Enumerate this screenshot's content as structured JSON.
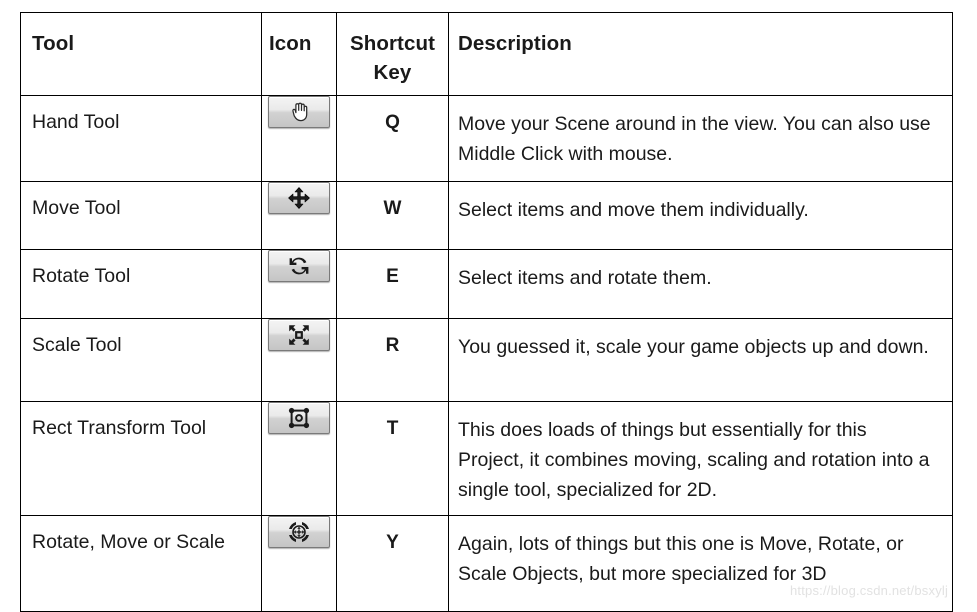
{
  "table": {
    "columns": [
      {
        "label": "Tool",
        "key": "tool"
      },
      {
        "label": "Icon",
        "key": "icon"
      },
      {
        "label": "Shortcut Key",
        "key": "shortcut"
      },
      {
        "label": "Description",
        "key": "description"
      }
    ],
    "header": {
      "tool": "Tool",
      "icon": "Icon",
      "shortcut_line1": "Shortcut",
      "shortcut_line2": "Key",
      "description": "Description"
    },
    "rows": [
      {
        "tool": "Hand Tool",
        "icon": "hand-tool-icon",
        "shortcut": "Q",
        "description": "Move your Scene around in the view. You can also use Middle Click with mouse."
      },
      {
        "tool": "Move Tool",
        "icon": "move-tool-icon",
        "shortcut": "W",
        "description": "Select items and move them individually."
      },
      {
        "tool": "Rotate Tool",
        "icon": "rotate-tool-icon",
        "shortcut": "E",
        "description": "Select items and rotate them."
      },
      {
        "tool": "Scale Tool",
        "icon": "scale-tool-icon",
        "shortcut": "R",
        "description": "You guessed it, scale your game objects up and down."
      },
      {
        "tool": "Rect Transform Tool",
        "icon": "rect-transform-tool-icon",
        "shortcut": "T",
        "description": "This does loads of things but essentially for this Project, it combines moving, scaling and rotation into a single tool, specialized for 2D."
      },
      {
        "tool": "Rotate, Move or Scale",
        "icon": "rotate-move-scale-tool-icon",
        "shortcut": "Y",
        "description": "Again, lots of things but this one is Move, Rotate, or Scale Objects, but more specialized for 3D"
      }
    ]
  },
  "watermark": {
    "text": "https://blog.csdn.net/bsxylj"
  },
  "colors": {
    "border": "#000000",
    "text": "#1a1a1a",
    "page_background": "#ffffff",
    "button_face": "#e4e4e4",
    "button_border": "#7a7a7a",
    "watermark": "#e2e2e2"
  }
}
